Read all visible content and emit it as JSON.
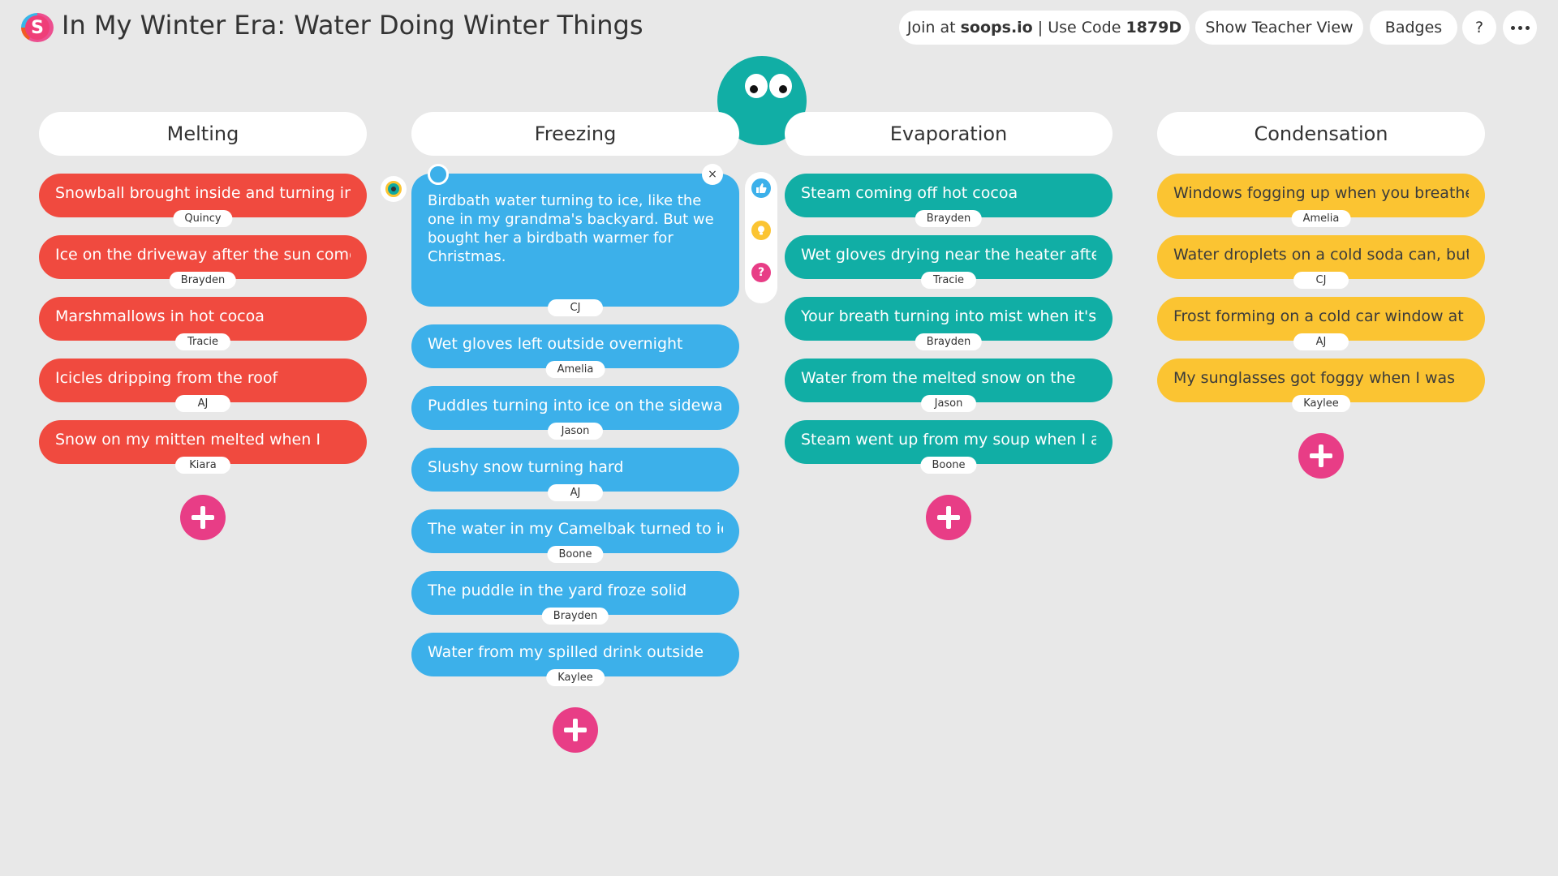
{
  "header": {
    "title": "In My Winter Era: Water Doing Winter Things",
    "join_prefix": "Join at ",
    "join_site": "soops.io",
    "join_mid": " | Use Code ",
    "join_code": "1879D",
    "teacher_view": "Show Teacher View",
    "badges": "Badges",
    "help": "?"
  },
  "columns": {
    "melting": {
      "title": "Melting",
      "color": "#f04a3f",
      "cards": [
        {
          "text": "Snowball brought inside and turning into",
          "author": "Quincy"
        },
        {
          "text": "Ice on the driveway after the sun comes",
          "author": "Brayden"
        },
        {
          "text": "Marshmallows in hot cocoa",
          "author": "Tracie"
        },
        {
          "text": "Icicles dripping from the roof",
          "author": "AJ"
        },
        {
          "text": "Snow on my mitten melted when I",
          "author": "Kiara"
        }
      ]
    },
    "freezing": {
      "title": "Freezing",
      "color": "#3cb0ea",
      "cards": [
        {
          "text": "Birdbath water turning to ice, like the one in my grandma's backyard. But we bought her a birdbath warmer for Christmas.",
          "author": "CJ"
        },
        {
          "text": "Wet gloves left outside overnight",
          "author": "Amelia"
        },
        {
          "text": "Puddles turning into ice on the sidewalk",
          "author": "Jason"
        },
        {
          "text": "Slushy snow turning hard",
          "author": "AJ"
        },
        {
          "text": "The water in my Camelbak turned to ice",
          "author": "Boone"
        },
        {
          "text": "The puddle in the yard froze solid",
          "author": "Brayden"
        },
        {
          "text": "Water from my spilled drink outside",
          "author": "Kaylee"
        }
      ]
    },
    "evaporation": {
      "title": "Evaporation",
      "color": "#11aea5",
      "cards": [
        {
          "text": "Steam coming off hot cocoa",
          "author": "Brayden"
        },
        {
          "text": "Wet gloves drying near the heater after",
          "author": "Tracie"
        },
        {
          "text": "Your breath turning into mist when it's",
          "author": "Brayden"
        },
        {
          "text": "Water from the melted snow on the",
          "author": "Jason"
        },
        {
          "text": "Steam went up from my soup when I ate",
          "author": "Boone"
        }
      ]
    },
    "condensation": {
      "title": "Condensation",
      "color": "#fbc432",
      "cards": [
        {
          "text": "Windows fogging up when you breathe",
          "author": "Amelia"
        },
        {
          "text": "Water droplets on a cold soda can, but",
          "author": "CJ"
        },
        {
          "text": "Frost forming on a cold car window at",
          "author": "AJ"
        },
        {
          "text": "My sunglasses got foggy when I was",
          "author": "Kaylee"
        }
      ]
    }
  },
  "card_controls": {
    "close": "×"
  },
  "reactions": {
    "question": "?"
  }
}
